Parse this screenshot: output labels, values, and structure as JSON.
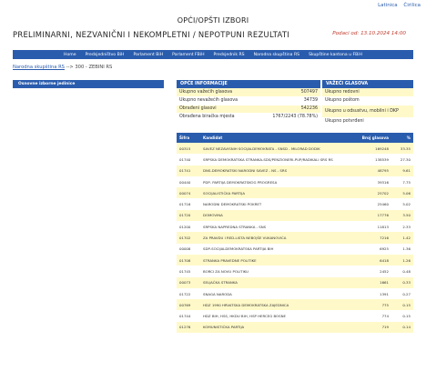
{
  "top_links": [
    "Latinica",
    "Ćirilica"
  ],
  "header": {
    "title_line1": "OPĆI/OPŠTI IZBORI",
    "title_line2": "PRELIMINARNI, NEZVANIČNI I NEKOMPLETNI / NEPOTPUNI REZULTATI",
    "published": "Podaci od:  13.10.2024 14:00"
  },
  "nav": [
    "Home",
    "Predsjedništvo BiH",
    "Parlament BiH",
    "Parlament FBiH",
    "Predsjednik RS",
    "Narodna skupština RS",
    "Skupštine kantona u FBiH"
  ],
  "breadcrumb": {
    "link": "Narodna skupština RS",
    "rest": " --> 300 - ZEBINI RS"
  },
  "left_panel": {
    "title": "Osnovne izborne jedinice"
  },
  "general": {
    "title": "OPĆE INFORMACIJE",
    "rows": [
      {
        "label": "Ukupno važećih glasova",
        "value": "507497"
      },
      {
        "label": "Ukupno nevažećih glasova",
        "value": "34739"
      },
      {
        "label": "Obrađeni glasovi",
        "value": "542236"
      },
      {
        "label": "Obrađena biračka mjesta",
        "value": "1767/2243 (78.78%)"
      }
    ]
  },
  "vazeci": {
    "title": "VAŽEĆI GLASOVA",
    "rows": [
      "Ukupno redovni",
      "Ukupno poštom",
      "Ukupno u odsustvu, mobilni i DKP",
      "Ukupno potvrđeni"
    ]
  },
  "results": {
    "headers": {
      "code": "Šifra",
      "name": "Kandidat",
      "votes": "Broj glasova",
      "pct": "%"
    },
    "rows": [
      {
        "code": "00315",
        "name": "SAVEZ NEZAVISNIH SOCIJALDEMOKRATA - SNSD - MILORAD DODIK",
        "votes": "169248",
        "pct": "33.35"
      },
      {
        "code": "01740",
        "name": "SRPSKA DEMOKRATSKA STRANKA-SDS/PENZIONERI-PUP/RADIKALI SRS RS",
        "votes": "138539",
        "pct": "27.30"
      },
      {
        "code": "01741",
        "name": "DNS-DEMOKRATSKI NARODNI SAVEZ - NS - SRS",
        "votes": "48795",
        "pct": "9.61"
      },
      {
        "code": "00440",
        "name": "PDP- PARTIJA DEMOKRATSKOG PROGRESA",
        "votes": "39316",
        "pct": "7.75"
      },
      {
        "code": "00074",
        "name": "SOCIJALISTIČKA PARTIJA",
        "votes": "25702",
        "pct": "5.06"
      },
      {
        "code": "01716",
        "name": "NARODNI DEMOKRATSKI POKRET",
        "votes": "25460",
        "pct": "5.02"
      },
      {
        "code": "01720",
        "name": "DOMOVINA",
        "votes": "17776",
        "pct": "3.50"
      },
      {
        "code": "01200",
        "name": "SRPSKA NAPREDNA STRANKA - SNS",
        "votes": "11813",
        "pct": "2.33"
      },
      {
        "code": "01702",
        "name": "ZA PRAVDU I RED-LISTA NEBOJŠE VUKANOVIĆA",
        "votes": "7216",
        "pct": "1.42"
      },
      {
        "code": "00008",
        "name": "SDP-SOCIJALDEMOKRATSKA PARTIJA BIH",
        "votes": "6925",
        "pct": "1.36"
      },
      {
        "code": "01708",
        "name": "STRANKA PRAVEDNE POLITIKE",
        "votes": "6418",
        "pct": "1.26"
      },
      {
        "code": "01745",
        "name": "BORCI ZA NOVU POLITIKU",
        "votes": "2452",
        "pct": "0.48"
      },
      {
        "code": "00073",
        "name": "SELJAČKA STRANKA",
        "votes": "1661",
        "pct": "0.33"
      },
      {
        "code": "01722",
        "name": "SNAGA NARODA",
        "votes": "1391",
        "pct": "0.27"
      },
      {
        "code": "00769",
        "name": "HDZ 1990 HRVATSKA DEMOKRATSKA ZAJEDNICA",
        "votes": "775",
        "pct": "0.15"
      },
      {
        "code": "01744",
        "name": "HDZ BIH, HSS, HKDU BIH, HSP HERCEG BOSNE",
        "votes": "774",
        "pct": "0.15"
      },
      {
        "code": "01276",
        "name": "KOMUNISTIČKA PARTIJA",
        "votes": "719",
        "pct": "0.14"
      }
    ]
  }
}
